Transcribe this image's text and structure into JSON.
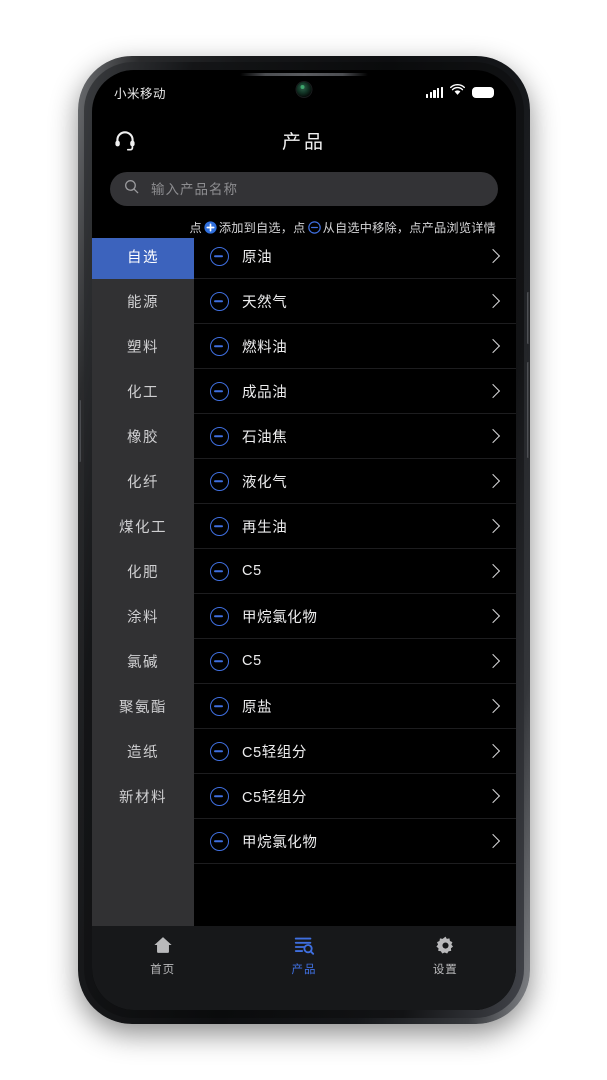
{
  "status_bar": {
    "carrier": "小米移动",
    "icons": [
      "signal-icon",
      "wifi-icon",
      "battery-icon"
    ]
  },
  "header": {
    "title": "产品",
    "left_icon": "headset-icon"
  },
  "search": {
    "icon": "search-icon",
    "placeholder": "输入产品名称",
    "value": ""
  },
  "hint": {
    "part1": "点",
    "plus_icon": "plus-circle-filled-icon",
    "part2": "添加到自选，点",
    "minus_icon": "minus-circle-outline-icon",
    "part3": "从自选中移除，点产品浏览详情"
  },
  "sidebar": {
    "items": [
      {
        "label": "自选",
        "active": true
      },
      {
        "label": "能源",
        "active": false
      },
      {
        "label": "塑料",
        "active": false
      },
      {
        "label": "化工",
        "active": false
      },
      {
        "label": "橡胶",
        "active": false
      },
      {
        "label": "化纤",
        "active": false
      },
      {
        "label": "煤化工",
        "active": false
      },
      {
        "label": "化肥",
        "active": false
      },
      {
        "label": "涂料",
        "active": false
      },
      {
        "label": "氯碱",
        "active": false
      },
      {
        "label": "聚氨酯",
        "active": false
      },
      {
        "label": "造纸",
        "active": false
      },
      {
        "label": "新材料",
        "active": false
      }
    ]
  },
  "products": [
    {
      "name": "原油"
    },
    {
      "name": "天然气"
    },
    {
      "name": "燃料油"
    },
    {
      "name": "成品油"
    },
    {
      "name": "石油焦"
    },
    {
      "name": "液化气"
    },
    {
      "name": "再生油"
    },
    {
      "name": "C5"
    },
    {
      "name": "甲烷氯化物"
    },
    {
      "name": "C5"
    },
    {
      "name": "原盐"
    },
    {
      "name": "C5轻组分"
    },
    {
      "name": "C5轻组分"
    },
    {
      "name": "甲烷氯化物"
    }
  ],
  "bottom_nav": [
    {
      "label": "首页",
      "icon": "home-icon",
      "active": false
    },
    {
      "label": "产品",
      "icon": "product-search-icon",
      "active": true
    },
    {
      "label": "设置",
      "icon": "gear-icon",
      "active": false
    }
  ],
  "colors": {
    "accent_blue": "#3f6fe0",
    "selected_blue": "#3c63bd",
    "sidebar_bg": "#313133",
    "screen_bg": "#000000",
    "nav_bg": "#17181a"
  }
}
